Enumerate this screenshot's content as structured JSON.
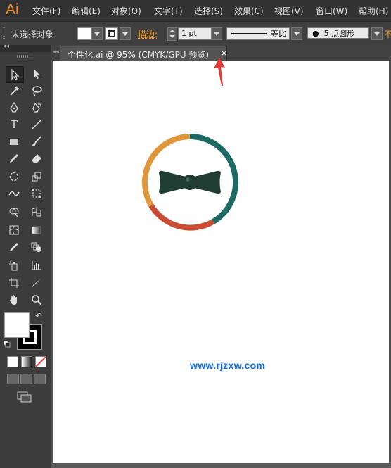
{
  "app": {
    "logo": "Ai",
    "accent": "#f28b21"
  },
  "menu": {
    "items": [
      "文件(F)",
      "编辑(E)",
      "对象(O)",
      "文字(T)",
      "选择(S)",
      "效果(C)",
      "视图(V)",
      "窗口(W)",
      "帮助(H)"
    ]
  },
  "control_bar": {
    "selection_label": "未选择对象",
    "stroke_label": "描边",
    "stroke_colon": ":",
    "stroke_weight": "1 pt",
    "profile_label": "等比",
    "brush_label": "5 点圆形",
    "extra_label": "不"
  },
  "toolbox": {
    "collapse_glyph": "◂◂"
  },
  "document": {
    "tab_title": "个性化.ai @ 95% (CMYK/GPU 预览)",
    "close_glyph": "×"
  },
  "artwork": {
    "ring_colors": {
      "teal": "#1c6a63",
      "orange": "#e0973b",
      "red": "#c84d33"
    },
    "bowtie_color": "#1f3d33"
  },
  "watermark": {
    "text": "www.rjzxw.com",
    "color": "#1a6fd1"
  },
  "annotation": {
    "pointer_color": "#e53935"
  }
}
